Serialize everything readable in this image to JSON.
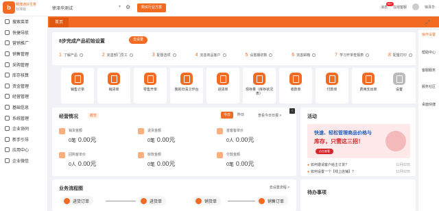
{
  "header": {
    "logo_char": "b",
    "brand_line1": "畅捷通好生意",
    "brand_line2": "标准版",
    "company_name": "徐泽华测试",
    "buy_button": "购买行业方案",
    "message_label": "消息",
    "message_badge": "99+",
    "service_label": "在线客服",
    "user_name": "徐泽华"
  },
  "sidebar": {
    "items": [
      {
        "label": "搜索菜单"
      },
      {
        "label": "快捷导航"
      },
      {
        "label": "营销推广"
      },
      {
        "label": "销售管理"
      },
      {
        "label": "采购管理"
      },
      {
        "label": "库存核算"
      },
      {
        "label": "资金管理"
      },
      {
        "label": "经营管理"
      },
      {
        "label": "基础信息"
      },
      {
        "label": "系统管理"
      },
      {
        "label": "企业协同"
      },
      {
        "label": "新手引导"
      },
      {
        "label": "应用中心"
      },
      {
        "label": "企业微信"
      }
    ]
  },
  "tabs": {
    "home": "首页"
  },
  "setup": {
    "title": "8步完成产品初始设置",
    "go_button": "去设置",
    "steps": [
      {
        "num": "1",
        "label": "了解产品"
      },
      {
        "num": "2",
        "label": "完善部门员工"
      },
      {
        "num": "3",
        "label": "配置选项"
      },
      {
        "num": "4",
        "label": "完善商品客户"
      },
      {
        "num": "5",
        "label": "设置期初数"
      },
      {
        "num": "6",
        "label": "完善邮箱"
      },
      {
        "num": "7",
        "label": "学习开单查报表"
      },
      {
        "num": "8",
        "label": "配置打印"
      }
    ]
  },
  "quick": {
    "items": [
      {
        "label": "销售订单"
      },
      {
        "label": "销货单"
      },
      {
        "label": "零售开单"
      },
      {
        "label": "我的日清工作台"
      },
      {
        "label": "进货单"
      },
      {
        "label": "现存量（库存状况表）"
      },
      {
        "label": "收款单"
      },
      {
        "label": "付款单"
      },
      {
        "label": "费用支出单"
      },
      {
        "label": "设置"
      }
    ]
  },
  "overview": {
    "title": "经营情况",
    "tag": "概览",
    "tab_today": "今日",
    "tab_yesterday": "昨日",
    "link": "查看今日日报 >",
    "stats": [
      {
        "label": "销货金额",
        "count": "0笔",
        "amount": "0.00元"
      },
      {
        "label": "退货金额",
        "count": "0笔",
        "amount": "0.00元"
      },
      {
        "label": "首客客单价",
        "count": "0人",
        "amount": "0.00元"
      },
      {
        "label": "回购客单价",
        "count": "0人",
        "amount": "0.00元"
      },
      {
        "label": "收款金额",
        "count": "0笔",
        "amount": "0.00元"
      },
      {
        "label": "付款金额",
        "count": "0笔",
        "amount": "0.00元"
      }
    ]
  },
  "process": {
    "title": "业务流程图",
    "link": "去设置流程 >",
    "nodes": [
      {
        "label": "进货订单"
      },
      {
        "label": "进货单"
      },
      {
        "label": "销货单"
      },
      {
        "label": "销售订单"
      }
    ]
  },
  "activity": {
    "title": "活动",
    "banner_line1": "快速、轻松管理商品价格与",
    "banner_line2": "库存，只需这三招！",
    "banner_button": "点击查看",
    "news": [
      {
        "title": "如何邀请客户给主订货?",
        "date": "11月02日"
      },
      {
        "title": "如何设置一个【线上店铺】?",
        "date": "11月02日"
      }
    ]
  },
  "todo": {
    "title": "待办事项"
  },
  "rail": {
    "items": [
      {
        "label": "操作设置"
      },
      {
        "label": "帮助中心"
      },
      {
        "label": "客服服务"
      },
      {
        "label": "服务社区"
      },
      {
        "label": "桌面快捷"
      }
    ]
  }
}
